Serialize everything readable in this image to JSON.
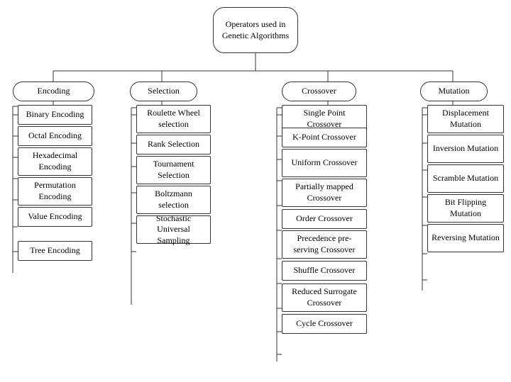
{
  "title": "Operators used in Genetic Algorithms",
  "categories": {
    "encoding": {
      "label": "Encoding",
      "items": [
        "Binary Encoding",
        "Octal Encoding",
        "Hexadecimal Encoding",
        "Permutation Encoding",
        "Value Encoding",
        "Tree Encoding"
      ]
    },
    "selection": {
      "label": "Selection",
      "items": [
        "Roulette Wheel selection",
        "Rank Selection",
        "Tournament Selection",
        "Boltzmann selection",
        "Stochastic Universal Sampling"
      ]
    },
    "crossover": {
      "label": "Crossover",
      "items": [
        "Single Point Crossover",
        "K-Point Crossover",
        "Uniform Crossover",
        "Partially mapped Crossover",
        "Order Crossover",
        "Precedence pre-serving Crossover",
        "Shuffle Crossover",
        "Reduced Surrogate Crossover",
        "Cycle Crossover"
      ]
    },
    "mutation": {
      "label": "Mutation",
      "items": [
        "Displacement Mutation",
        "Inversion Mutation",
        "Scramble Mutation",
        "Bit Flipping Mutation",
        "Reversing Mutation"
      ]
    }
  }
}
